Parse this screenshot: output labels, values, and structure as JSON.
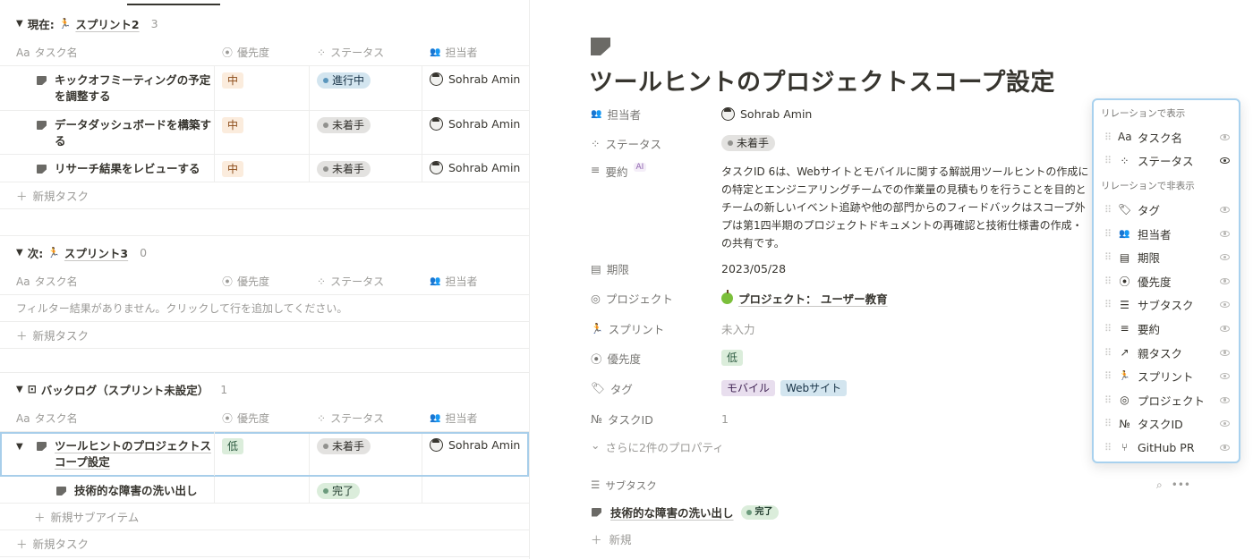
{
  "board": {
    "groups": [
      {
        "prefix": "現在:",
        "sprint": "スプリント2",
        "count": "3",
        "headers": [
          "タスク名",
          "優先度",
          "ステータス",
          "担当者"
        ],
        "header_icons": [
          "Aa",
          "⦿",
          "⁘",
          "👥"
        ],
        "rows": [
          {
            "title": "キックオフミーティングの予定を調整する",
            "priority": "中",
            "status": "進行中",
            "assignee": "Sohrab Amin"
          },
          {
            "title": "データダッシュボードを構築する",
            "priority": "中",
            "status": "未着手",
            "assignee": "Sohrab Amin"
          },
          {
            "title": "リサーチ結果をレビューする",
            "priority": "中",
            "status": "未着手",
            "assignee": "Sohrab Amin"
          }
        ],
        "new_task": "新規タスク"
      },
      {
        "prefix": "次:",
        "sprint": "スプリント3",
        "count": "0",
        "headers": [
          "タスク名",
          "優先度",
          "ステータス",
          "担当者"
        ],
        "empty_message": "フィルター結果がありません。クリックして行を追加してください。",
        "new_task": "新規タスク"
      },
      {
        "title": "バックログ（スプリント未設定）",
        "count": "1",
        "headers": [
          "タスク名",
          "優先度",
          "ステータス",
          "担当者"
        ],
        "row": {
          "title": "ツールヒントのプロジェクトスコープ設定",
          "priority": "低",
          "status": "未着手",
          "assignee": "Sohrab Amin"
        },
        "subrow": {
          "title": "技術的な障害の洗い出し",
          "status": "完了"
        },
        "new_subitem": "新規サブアイテム",
        "new_task": "新規タスク"
      }
    ]
  },
  "page": {
    "title": "ツールヒントのプロジェクトスコープ設定",
    "props": {
      "assignee": {
        "label": "担当者",
        "value": "Sohrab Amin"
      },
      "status": {
        "label": "ステータス",
        "value": "未着手"
      },
      "summary": {
        "label": "要約",
        "badge": "AI",
        "lines": [
          "タスクID 6は、Webサイトとモバイルに関する解説用ツールヒントの作成に",
          "の特定とエンジニアリングチームでの作業量の見積もりを行うことを目的と",
          "チームの新しいイベント追跡や他の部門からのフィードバックはスコープ外",
          "プは第1四半期のプロジェクトドキュメントの再確認と技術仕様書の作成・",
          "の共有です。"
        ]
      },
      "due": {
        "label": "期限",
        "value": "2023/05/28"
      },
      "project": {
        "label": "プロジェクト",
        "value": "プロジェクト： ユーザー教育"
      },
      "sprint": {
        "label": "スプリント",
        "value": "未入力"
      },
      "priority": {
        "label": "優先度",
        "value": "低"
      },
      "tags": {
        "label": "タグ",
        "values": [
          "モバイル",
          "Webサイト"
        ]
      },
      "task_id": {
        "label": "タスクID",
        "value": "1"
      }
    },
    "more_props": "さらに2件のプロパティ",
    "subtasks": {
      "label": "サブタスク",
      "item": "技術的な障害の洗い出し",
      "item_status": "完了",
      "new": "新規"
    }
  },
  "popover": {
    "shown_label": "リレーションで表示",
    "shown": [
      {
        "icon": "Aa",
        "label": "タスク名",
        "visible": true
      },
      {
        "icon": "⁘",
        "label": "ステータス",
        "visible": true
      }
    ],
    "hidden_label": "リレーションで非表示",
    "hidden": [
      {
        "icon": "🏷",
        "label": "タグ"
      },
      {
        "icon": "👥",
        "label": "担当者"
      },
      {
        "icon": "▤",
        "label": "期限"
      },
      {
        "icon": "⦿",
        "label": "優先度"
      },
      {
        "icon": "☰",
        "label": "サブタスク"
      },
      {
        "icon": "≡",
        "label": "要約"
      },
      {
        "icon": "↗",
        "label": "親タスク"
      },
      {
        "icon": "🏃",
        "label": "スプリント"
      },
      {
        "icon": "◎",
        "label": "プロジェクト"
      },
      {
        "icon": "№",
        "label": "タスクID"
      },
      {
        "icon": "⑂",
        "label": "GitHub PR"
      }
    ]
  }
}
